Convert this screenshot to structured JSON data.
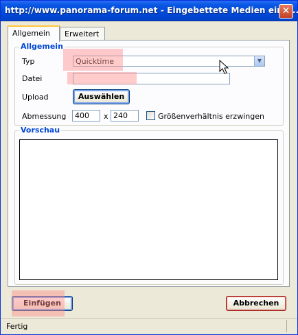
{
  "window": {
    "title": "http://www.panorama-forum.net - Eingebettete Medien einfü...",
    "close_symbol": "✕"
  },
  "tabs": [
    {
      "label": "Allgemein",
      "active": true
    },
    {
      "label": "Erweitert",
      "active": false
    }
  ],
  "general_group": {
    "legend": "Allgemein",
    "type_label": "Typ",
    "type_value": "Quicktime",
    "file_label": "Datei",
    "file_value": "",
    "upload_label": "Upload",
    "upload_button": "Auswählen",
    "dimension_label": "Abmessung",
    "width_value": "400",
    "times_symbol": "x",
    "height_value": "240",
    "aspect_checkbox_label": "Größenverhältnis erzwingen",
    "aspect_checked": false
  },
  "preview_group": {
    "legend": "Vorschau"
  },
  "actions": {
    "insert_button": "Einfügen",
    "cancel_button": "Abbrechen"
  },
  "statusbar": {
    "text": "Fertig"
  },
  "colors": {
    "titlebar": "#0a58e3",
    "legend_text": "#0046d5",
    "window_bg": "#ece9d8",
    "highlight": "#ff8c8c"
  },
  "icons": {
    "close": "close-icon",
    "dropdown": "chevron-down-icon",
    "cursor": "mouse-pointer-icon"
  }
}
